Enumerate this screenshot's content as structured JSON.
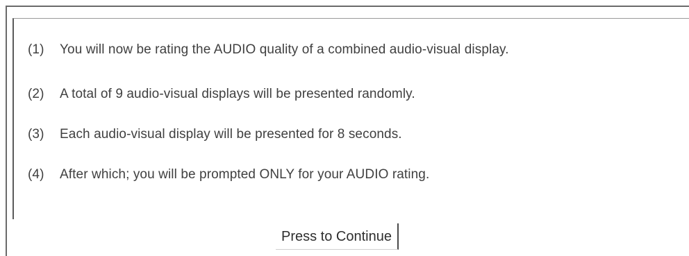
{
  "instructions": [
    {
      "num": "(1)",
      "text": "You will now be rating the AUDIO quality of a combined audio-visual display."
    },
    {
      "num": "(2)",
      "text": "A total of 9 audio-visual displays will be presented randomly."
    },
    {
      "num": "(3)",
      "text": "Each audio-visual display will be presented for 8 seconds."
    },
    {
      "num": "(4)",
      "text": "After which; you will be prompted ONLY for your AUDIO rating."
    }
  ],
  "continue_button": {
    "label": "Press to Continue"
  }
}
